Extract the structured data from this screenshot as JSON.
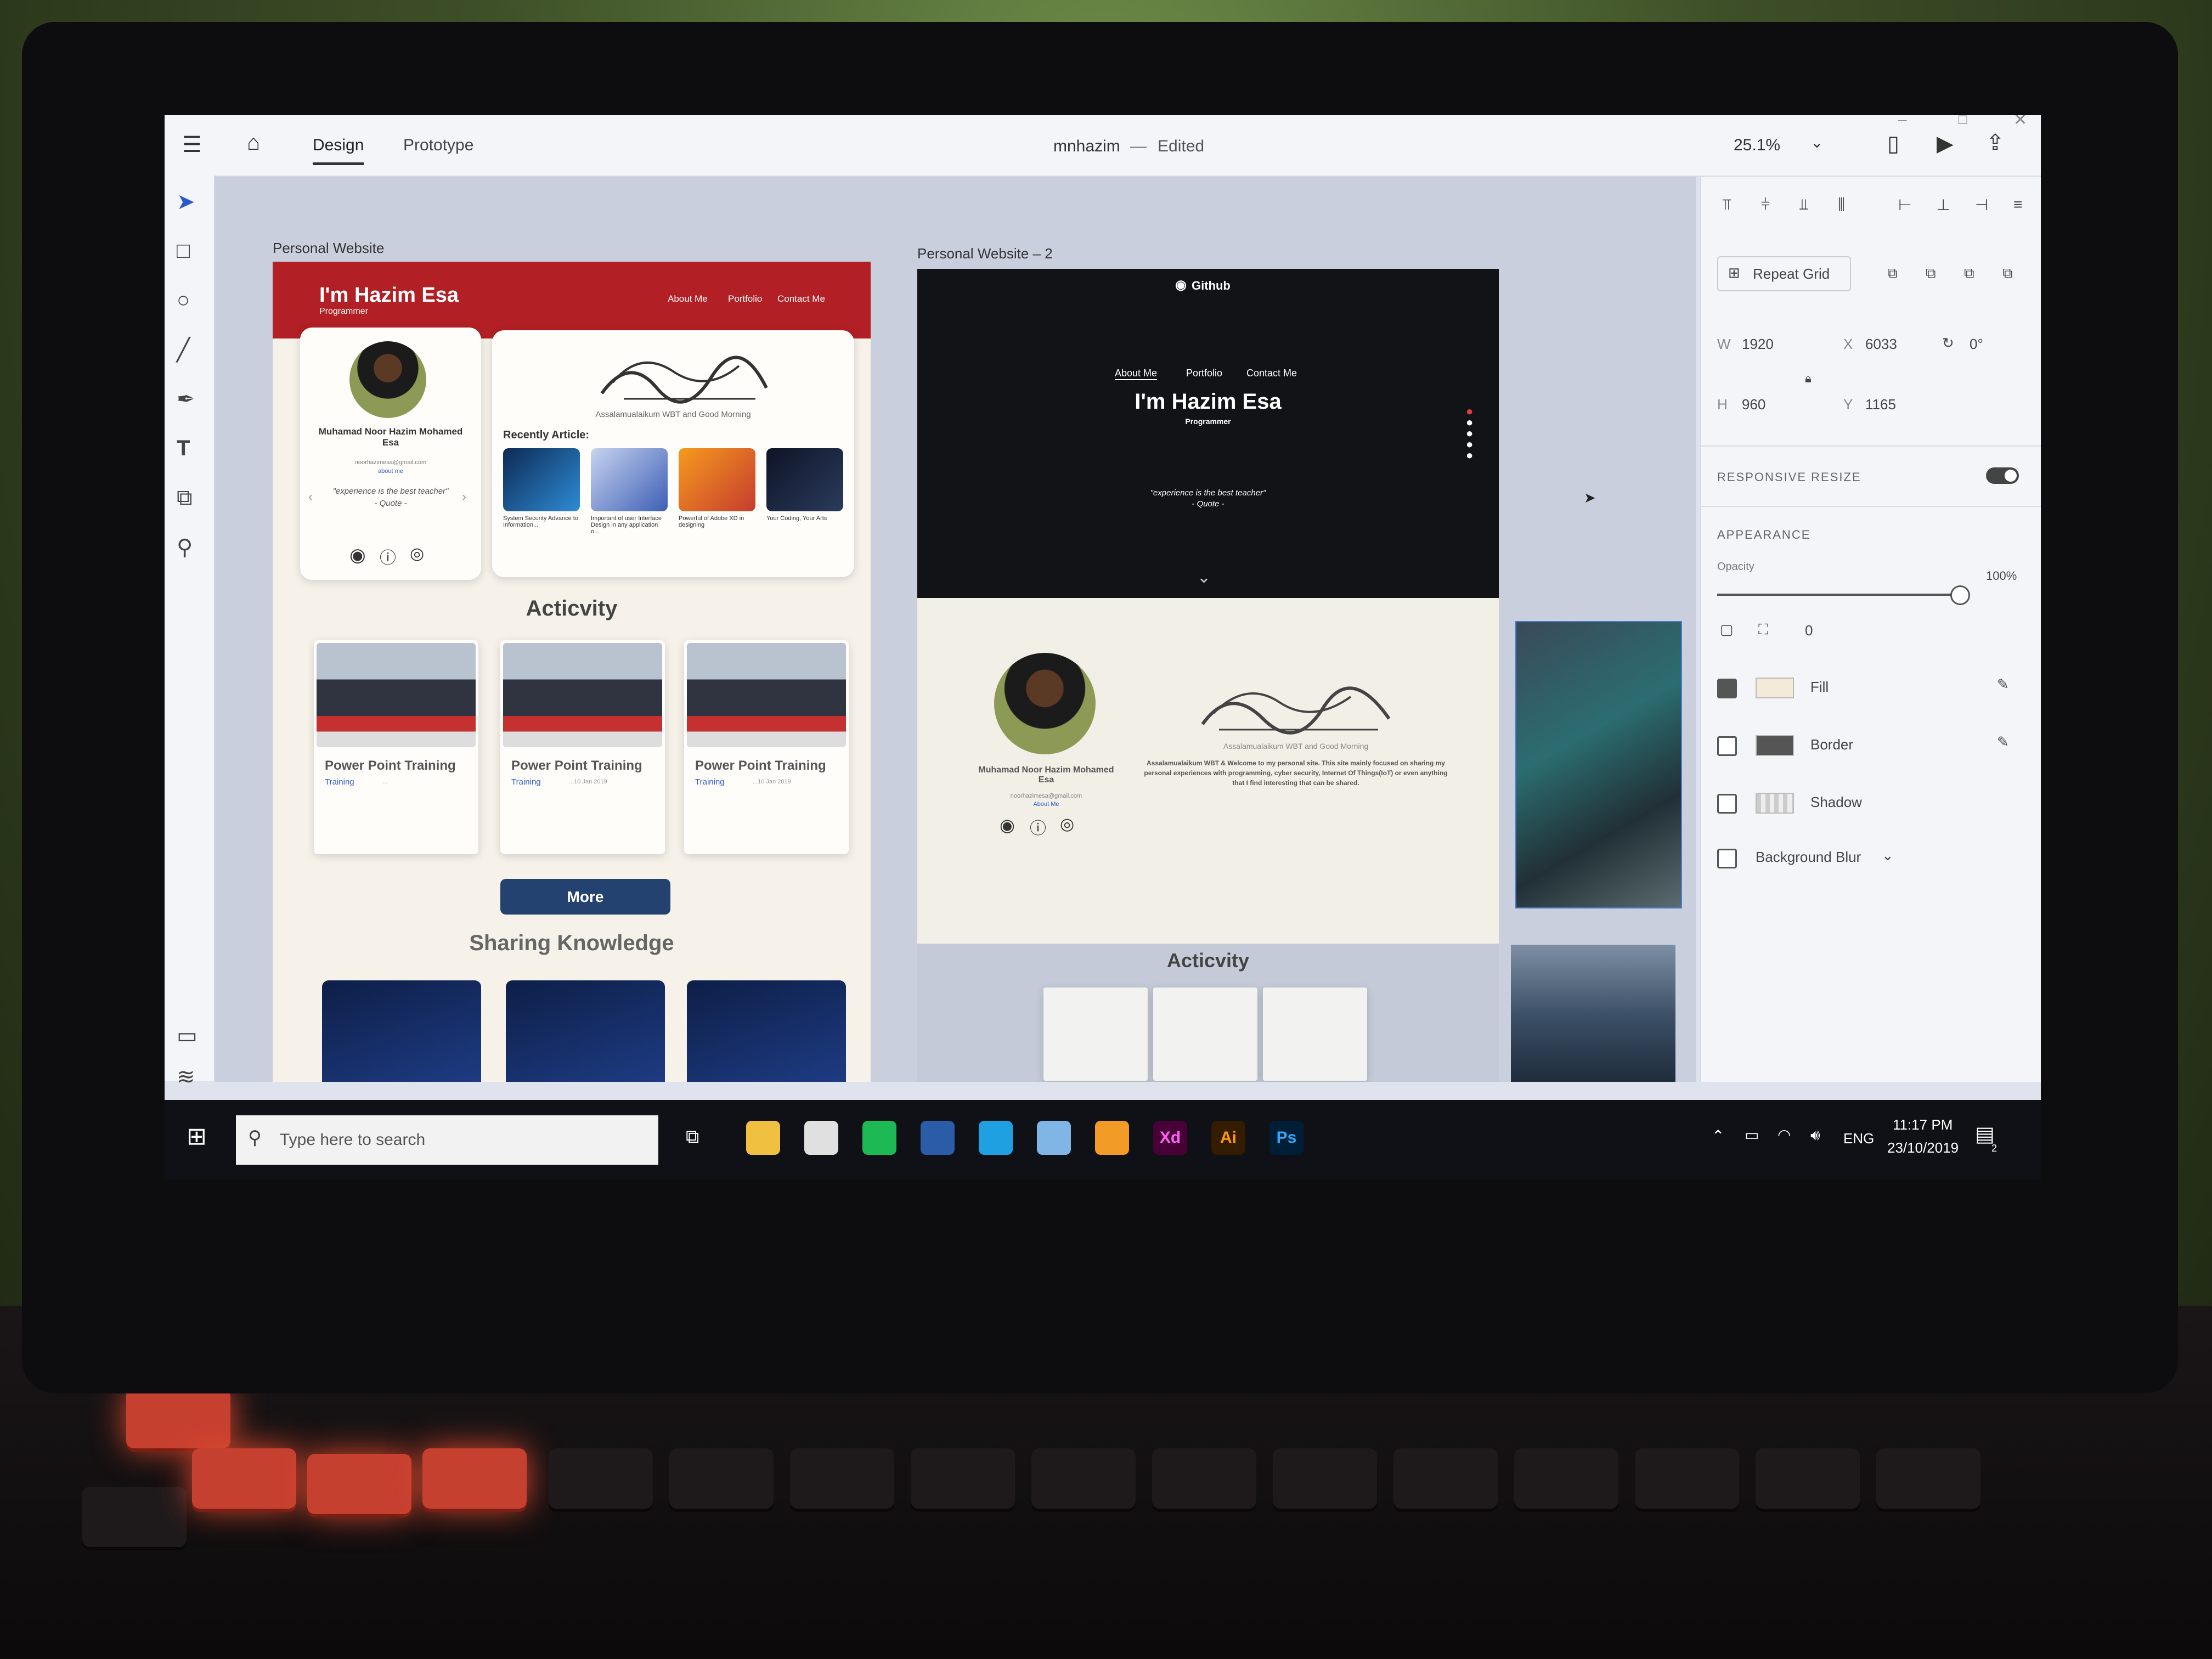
{
  "app": {
    "document_name": "mnhazim",
    "status": "Edited",
    "tabs": [
      "Design",
      "Prototype"
    ],
    "zoom": "25.1%"
  },
  "artboards": {
    "one": {
      "label": "Personal Website",
      "hero_name": "I'm Hazim Esa",
      "hero_role": "Programmer",
      "nav": [
        "About Me",
        "Portfolio",
        "Contact Me"
      ],
      "profile_name": "Muhamad Noor Hazim Mohamed Esa",
      "profile_email": "noorhazimesa@gmail.com",
      "profile_link": "about me",
      "quote": "\"experience is the best teacher\"",
      "quote_author": "- Quote -",
      "greeting": "Assalamualaikum WBT and Good Morning",
      "recent_title": "Recently Article:",
      "articles": [
        {
          "caption": "System Security Advance to Information..."
        },
        {
          "caption": "Important of user Interface Design in any application o..."
        },
        {
          "caption": "Powerful of Adobe XD in designing"
        },
        {
          "caption": "Your Coding, Your Arts"
        }
      ],
      "activity_title": "Acticvity",
      "activity_cards": [
        {
          "title": "Power Point Training",
          "tag": "Training",
          "date": "..."
        },
        {
          "title": "Power Point Training",
          "tag": "Training",
          "date": "...10 Jan 2019"
        },
        {
          "title": "Power Point Training",
          "tag": "Training",
          "date": "...10 Jan 2019"
        }
      ],
      "more_button": "More",
      "sharing_title": "Sharing Knowledge"
    },
    "two": {
      "label": "Personal Website – 2",
      "brand": "Github",
      "nav": [
        "About Me",
        "Portfolio",
        "Contact Me"
      ],
      "hero_name": "I'm Hazim Esa",
      "hero_role": "Programmer",
      "quote": "\"experience is the best teacher\"",
      "quote_author": "- Quote -",
      "profile_name": "Muhamad Noor Hazim Mohamed Esa",
      "profile_email": "noorhazimesa@gmail.com",
      "profile_link": "About Me",
      "greeting": "Assalamualaikum WBT and Good Morning",
      "intro": "Assalamualaikum WBT & Welcome to my personal site. This site mainly focused on sharing my personal experiences with programming, cyber security, Internet Of Things(IoT) or even anything that I find interesting that can be shared.",
      "activity_title": "Acticvity"
    }
  },
  "properties": {
    "repeat_grid": "Repeat Grid",
    "w_label": "W",
    "w": "1920",
    "h_label": "H",
    "h": "960",
    "x_label": "X",
    "x": "6033",
    "y_label": "Y",
    "y": "1165",
    "rotation": "0°",
    "responsive_resize": "RESPONSIVE RESIZE",
    "appearance": "APPEARANCE",
    "opacity_label": "Opacity",
    "opacity": "100%",
    "opacity_level": 1.0,
    "radius": "0",
    "fill": "Fill",
    "border": "Border",
    "shadow": "Shadow",
    "background_blur": "Background Blur"
  },
  "taskbar": {
    "search_placeholder": "Type here to search",
    "lang": "ENG",
    "time": "11:17 PM",
    "date": "23/10/2019",
    "notification_count": "2",
    "apps": [
      {
        "name": "file-explorer",
        "label": "",
        "color": "#f0c040"
      },
      {
        "name": "chrome",
        "label": "",
        "color": "#e0e0e0"
      },
      {
        "name": "spotify",
        "label": "",
        "color": "#1db954"
      },
      {
        "name": "powershell",
        "label": "",
        "color": "#2a5ca8"
      },
      {
        "name": "edge",
        "label": "",
        "color": "#1fa0e0"
      },
      {
        "name": "app-blue",
        "label": "",
        "color": "#7fb6e6"
      },
      {
        "name": "sublime",
        "label": "",
        "color": "#f29b27"
      },
      {
        "name": "adobe-xd",
        "label": "Xd",
        "color": "#470137"
      },
      {
        "name": "illustrator",
        "label": "Ai",
        "color": "#331c00"
      },
      {
        "name": "photoshop",
        "label": "Ps",
        "color": "#001e36"
      }
    ]
  },
  "colors": {
    "accent_red": "#b21f24",
    "brand_blue": "#23426f",
    "xd_pink": "#ff61f6"
  }
}
